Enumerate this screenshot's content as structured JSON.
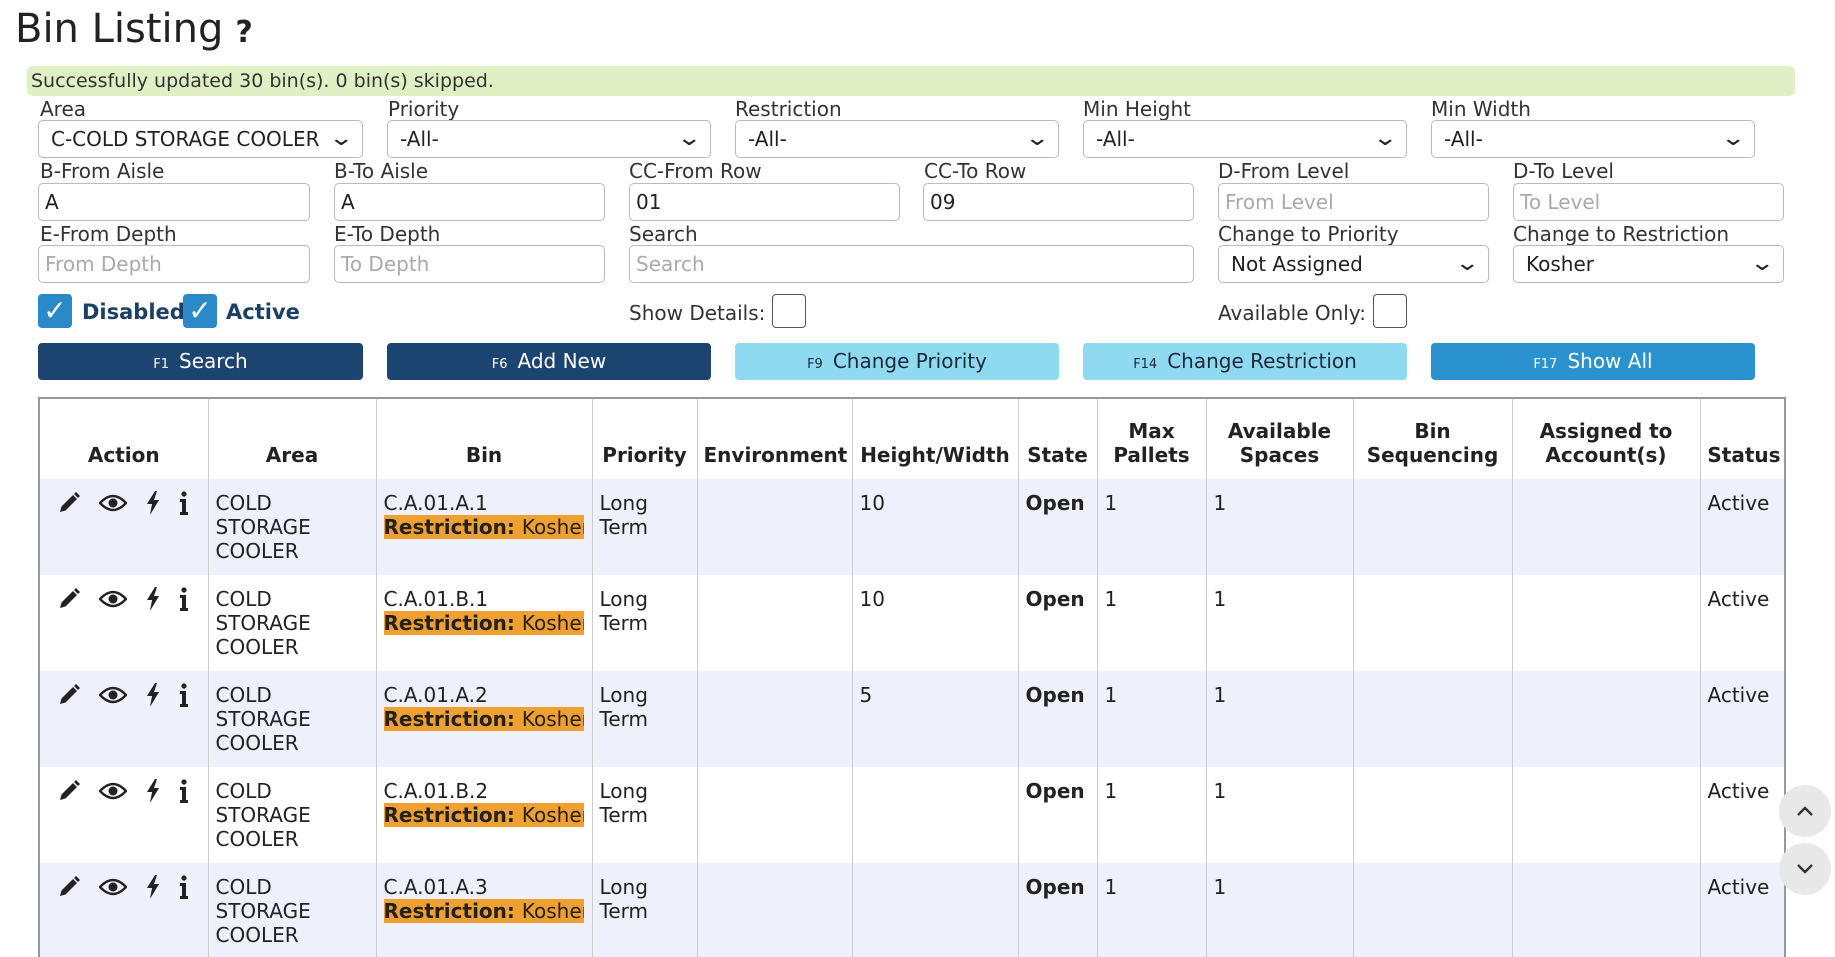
{
  "page": {
    "title": "Bin Listing",
    "help": "?"
  },
  "alert": {
    "message": "Successfully updated 30 bin(s). 0 bin(s) skipped."
  },
  "filters": {
    "area": {
      "label": "Area",
      "value": "C-COLD STORAGE COOLER"
    },
    "priority": {
      "label": "Priority",
      "value": "-All-"
    },
    "restriction": {
      "label": "Restriction",
      "value": "-All-"
    },
    "min_height": {
      "label": "Min Height",
      "value": "-All-"
    },
    "min_width": {
      "label": "Min Width",
      "value": "-All-"
    },
    "from_aisle": {
      "label": "B-From Aisle",
      "value": "A"
    },
    "to_aisle": {
      "label": "B-To Aisle",
      "value": "A"
    },
    "from_row": {
      "label": "CC-From Row",
      "value": "01"
    },
    "to_row": {
      "label": "CC-To Row",
      "value": "09"
    },
    "from_level": {
      "label": "D-From Level",
      "placeholder": "From Level"
    },
    "to_level": {
      "label": "D-To Level",
      "placeholder": "To Level"
    },
    "from_depth": {
      "label": "E-From Depth",
      "placeholder": "From Depth"
    },
    "to_depth": {
      "label": "E-To Depth",
      "placeholder": "To Depth"
    },
    "search": {
      "label": "Search",
      "placeholder": "Search"
    },
    "change_priority": {
      "label": "Change to Priority",
      "value": "Not Assigned"
    },
    "change_restriction": {
      "label": "Change to Restriction",
      "value": "Kosher"
    },
    "disabled": {
      "label": "Disabled",
      "checked": true
    },
    "active": {
      "label": "Active",
      "checked": true
    },
    "show_details": {
      "label": "Show Details:",
      "checked": false
    },
    "available_only": {
      "label": "Available Only:",
      "checked": false
    }
  },
  "buttons": {
    "search": {
      "key": "F1",
      "label": "Search"
    },
    "add_new": {
      "key": "F6",
      "label": "Add New"
    },
    "change_priority": {
      "key": "F9",
      "label": "Change Priority"
    },
    "change_restriction": {
      "key": "F14",
      "label": "Change Restriction"
    },
    "show_all": {
      "key": "F17",
      "label": "Show All"
    }
  },
  "table": {
    "headers": {
      "action": "Action",
      "area": "Area",
      "bin": "Bin",
      "priority": "Priority",
      "environment": "Environment",
      "height_width": "Height/Width",
      "state": "State",
      "max_pallets_1": "Max",
      "max_pallets_2": "Pallets",
      "available_1": "Available",
      "available_2": "Spaces",
      "sequencing_1": "Bin",
      "sequencing_2": "Sequencing",
      "assigned_1": "Assigned to",
      "assigned_2": "Account(s)",
      "status": "Status"
    },
    "restriction_label": "Restriction:",
    "rows": [
      {
        "area1": "COLD",
        "area2": "STORAGE",
        "area3": "COOLER",
        "bin": "C.A.01.A.1",
        "restriction": "Kosher",
        "priority1": "Long",
        "priority2": "Term",
        "environment": "",
        "height_width": "10",
        "state": "Open",
        "max_pallets": "1",
        "available": "1",
        "sequencing": "",
        "assigned": "",
        "status": "Active"
      },
      {
        "area1": "COLD",
        "area2": "STORAGE",
        "area3": "COOLER",
        "bin": "C.A.01.B.1",
        "restriction": "Kosher",
        "priority1": "Long",
        "priority2": "Term",
        "environment": "",
        "height_width": "10",
        "state": "Open",
        "max_pallets": "1",
        "available": "1",
        "sequencing": "",
        "assigned": "",
        "status": "Active"
      },
      {
        "area1": "COLD",
        "area2": "STORAGE",
        "area3": "COOLER",
        "bin": "C.A.01.A.2",
        "restriction": "Kosher",
        "priority1": "Long",
        "priority2": "Term",
        "environment": "",
        "height_width": "5",
        "state": "Open",
        "max_pallets": "1",
        "available": "1",
        "sequencing": "",
        "assigned": "",
        "status": "Active"
      },
      {
        "area1": "COLD",
        "area2": "STORAGE",
        "area3": "COOLER",
        "bin": "C.A.01.B.2",
        "restriction": "Kosher",
        "priority1": "Long",
        "priority2": "Term",
        "environment": "",
        "height_width": "",
        "state": "Open",
        "max_pallets": "1",
        "available": "1",
        "sequencing": "",
        "assigned": "",
        "status": "Active"
      },
      {
        "area1": "COLD",
        "area2": "STORAGE",
        "area3": "COOLER",
        "bin": "C.A.01.A.3",
        "restriction": "Kosher",
        "priority1": "Long",
        "priority2": "Term",
        "environment": "",
        "height_width": "",
        "state": "Open",
        "max_pallets": "1",
        "available": "1",
        "sequencing": "",
        "assigned": "",
        "status": "Active"
      }
    ]
  },
  "icons": [
    "edit-icon",
    "view-icon",
    "bolt-icon",
    "info-icon",
    "scroll-up-icon",
    "scroll-down-icon"
  ],
  "colors": {
    "primary": "#1b4470",
    "light_button": "#8fd9f1",
    "accent_button": "#2a93cf",
    "alert_bg": "#dff0c4",
    "restriction_bg": "#f0a030",
    "row_alt": "#eef0fb"
  }
}
